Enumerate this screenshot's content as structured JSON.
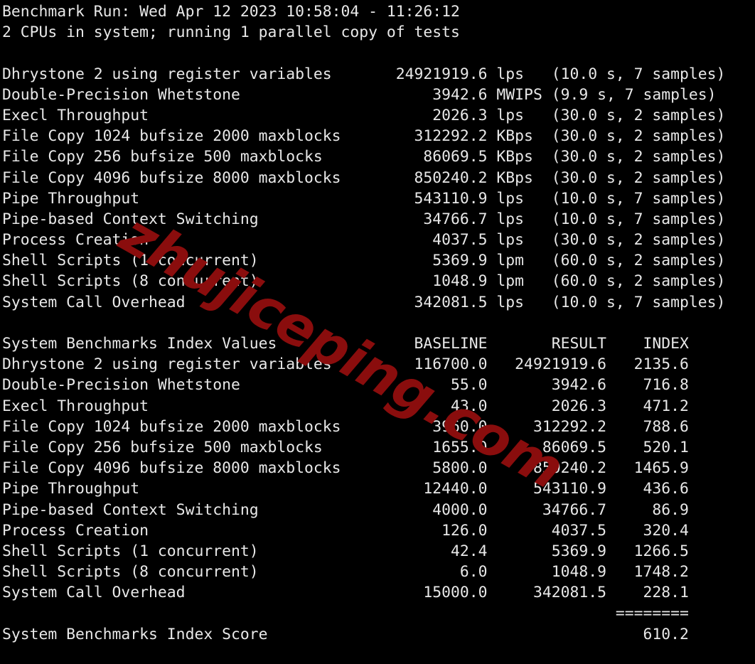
{
  "terminal": {
    "background_color": "#000000",
    "text_color": "#e8e8e8",
    "watermark_color": "#8a0d0d",
    "watermark_text": "zhujiceping.com"
  },
  "header": {
    "rule": "------------------------------------------------------------------------",
    "run_line": "Benchmark Run: Wed Apr 12 2023 10:58:04 - 11:26:12",
    "cpu_line": "2 CPUs in system; running 1 parallel copy of tests",
    "run_label": "Benchmark Run:",
    "run_date": "Wed Apr 12 2023",
    "run_start": "10:58:04",
    "run_end": "11:26:12",
    "cpu_count": "2",
    "parallel_copies": "1"
  },
  "raw_results": [
    {
      "name": "Dhrystone 2 using register variables",
      "value": "24921919.6",
      "unit": "lps",
      "duration": "10.0 s",
      "samples": "7 samples"
    },
    {
      "name": "Double-Precision Whetstone",
      "value": "3942.6",
      "unit": "MWIPS",
      "duration": "9.9 s",
      "samples": "7 samples"
    },
    {
      "name": "Execl Throughput",
      "value": "2026.3",
      "unit": "lps",
      "duration": "30.0 s",
      "samples": "2 samples"
    },
    {
      "name": "File Copy 1024 bufsize 2000 maxblocks",
      "value": "312292.2",
      "unit": "KBps",
      "duration": "30.0 s",
      "samples": "2 samples"
    },
    {
      "name": "File Copy 256 bufsize 500 maxblocks",
      "value": "86069.5",
      "unit": "KBps",
      "duration": "30.0 s",
      "samples": "2 samples"
    },
    {
      "name": "File Copy 4096 bufsize 8000 maxblocks",
      "value": "850240.2",
      "unit": "KBps",
      "duration": "30.0 s",
      "samples": "2 samples"
    },
    {
      "name": "Pipe Throughput",
      "value": "543110.9",
      "unit": "lps",
      "duration": "10.0 s",
      "samples": "7 samples"
    },
    {
      "name": "Pipe-based Context Switching",
      "value": "34766.7",
      "unit": "lps",
      "duration": "10.0 s",
      "samples": "7 samples"
    },
    {
      "name": "Process Creation",
      "value": "4037.5",
      "unit": "lps",
      "duration": "30.0 s",
      "samples": "2 samples"
    },
    {
      "name": "Shell Scripts (1 concurrent)",
      "value": "5369.9",
      "unit": "lpm",
      "duration": "60.0 s",
      "samples": "2 samples"
    },
    {
      "name": "Shell Scripts (8 concurrent)",
      "value": "1048.9",
      "unit": "lpm",
      "duration": "60.0 s",
      "samples": "2 samples"
    },
    {
      "name": "System Call Overhead",
      "value": "342081.5",
      "unit": "lps",
      "duration": "10.0 s",
      "samples": "7 samples"
    }
  ],
  "index_table": {
    "title": "System Benchmarks Index Values",
    "columns": [
      "BASELINE",
      "RESULT",
      "INDEX"
    ],
    "rows": [
      {
        "name": "Dhrystone 2 using register variables",
        "baseline": "116700.0",
        "result": "24921919.6",
        "index": "2135.6"
      },
      {
        "name": "Double-Precision Whetstone",
        "baseline": "55.0",
        "result": "3942.6",
        "index": "716.8"
      },
      {
        "name": "Execl Throughput",
        "baseline": "43.0",
        "result": "2026.3",
        "index": "471.2"
      },
      {
        "name": "File Copy 1024 bufsize 2000 maxblocks",
        "baseline": "3960.0",
        "result": "312292.2",
        "index": "788.6"
      },
      {
        "name": "File Copy 256 bufsize 500 maxblocks",
        "baseline": "1655.0",
        "result": "86069.5",
        "index": "520.1"
      },
      {
        "name": "File Copy 4096 bufsize 8000 maxblocks",
        "baseline": "5800.0",
        "result": "850240.2",
        "index": "1465.9"
      },
      {
        "name": "Pipe Throughput",
        "baseline": "12440.0",
        "result": "543110.9",
        "index": "436.6"
      },
      {
        "name": "Pipe-based Context Switching",
        "baseline": "4000.0",
        "result": "34766.7",
        "index": "86.9"
      },
      {
        "name": "Process Creation",
        "baseline": "126.0",
        "result": "4037.5",
        "index": "320.4"
      },
      {
        "name": "Shell Scripts (1 concurrent)",
        "baseline": "42.4",
        "result": "5369.9",
        "index": "1266.5"
      },
      {
        "name": "Shell Scripts (8 concurrent)",
        "baseline": "6.0",
        "result": "1048.9",
        "index": "1748.2"
      },
      {
        "name": "System Call Overhead",
        "baseline": "15000.0",
        "result": "342081.5",
        "index": "228.1"
      }
    ],
    "separator": "========",
    "score_label": "System Benchmarks Index Score",
    "score_value": "610.2"
  },
  "lines": [
    "------------------------------------------------------------------------",
    "Benchmark Run: Wed Apr 12 2023 10:58:04 - 11:26:12",
    "2 CPUs in system; running 1 parallel copy of tests",
    "",
    "Dhrystone 2 using register variables       24921919.6 lps   (10.0 s, 7 samples)",
    "Double-Precision Whetstone                     3942.6 MWIPS (9.9 s, 7 samples)",
    "Execl Throughput                               2026.3 lps   (30.0 s, 2 samples)",
    "File Copy 1024 bufsize 2000 maxblocks        312292.2 KBps  (30.0 s, 2 samples)",
    "File Copy 256 bufsize 500 maxblocks           86069.5 KBps  (30.0 s, 2 samples)",
    "File Copy 4096 bufsize 8000 maxblocks        850240.2 KBps  (30.0 s, 2 samples)",
    "Pipe Throughput                              543110.9 lps   (10.0 s, 7 samples)",
    "Pipe-based Context Switching                  34766.7 lps   (10.0 s, 7 samples)",
    "Process Creation                               4037.5 lps   (30.0 s, 2 samples)",
    "Shell Scripts (1 concurrent)                   5369.9 lpm   (60.0 s, 2 samples)",
    "Shell Scripts (8 concurrent)                   1048.9 lpm   (60.0 s, 2 samples)",
    "System Call Overhead                         342081.5 lps   (10.0 s, 7 samples)",
    "",
    "System Benchmarks Index Values               BASELINE       RESULT    INDEX",
    "Dhrystone 2 using register variables         116700.0   24921919.6   2135.6",
    "Double-Precision Whetstone                       55.0       3942.6    716.8",
    "Execl Throughput                                 43.0       2026.3    471.2",
    "File Copy 1024 bufsize 2000 maxblocks          3960.0     312292.2    788.6",
    "File Copy 256 bufsize 500 maxblocks            1655.0      86069.5    520.1",
    "File Copy 4096 bufsize 8000 maxblocks          5800.0     850240.2   1465.9",
    "Pipe Throughput                               12440.0     543110.9    436.6",
    "Pipe-based Context Switching                   4000.0      34766.7     86.9",
    "Process Creation                                126.0       4037.5    320.4",
    "Shell Scripts (1 concurrent)                     42.4       5369.9   1266.5",
    "Shell Scripts (8 concurrent)                      6.0       1048.9   1748.2",
    "System Call Overhead                          15000.0     342081.5    228.1",
    "                                                                   ========",
    "System Benchmarks Index Score                                         610.2"
  ]
}
